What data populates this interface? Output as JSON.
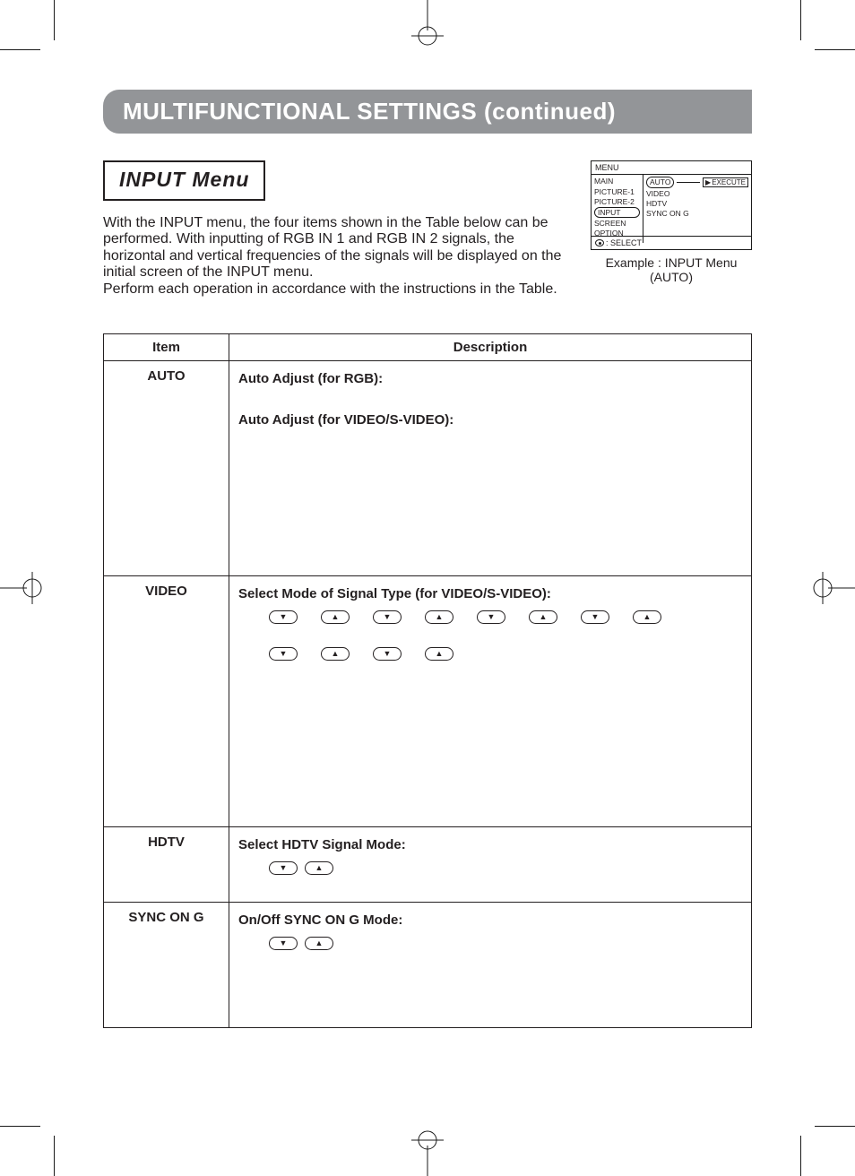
{
  "banner": "MULTIFUNCTIONAL SETTINGS (continued)",
  "section_title": "INPUT Menu",
  "intro": {
    "p1": "With the INPUT menu, the four items shown in the Table below can be performed. With inputting of RGB IN 1 and RGB IN 2 signals, the horizontal and vertical frequencies of the signals will be displayed on the initial screen of the INPUT menu.",
    "p2": "Perform each operation in accordance with the instructions in the Table."
  },
  "osd": {
    "title": "MENU",
    "left": [
      "MAIN",
      "PICTURE-1",
      "PICTURE-2",
      "INPUT",
      "SCREEN",
      "OPTION"
    ],
    "right": [
      "AUTO",
      "VIDEO",
      "HDTV",
      "SYNC ON G"
    ],
    "execute": "EXECUTE",
    "selected_left": "INPUT",
    "selected_right": "AUTO",
    "footer_icon": "disc-icon",
    "footer": ": SELECT",
    "caption_line1": "Example : INPUT Menu",
    "caption_line2": "(AUTO)"
  },
  "table": {
    "headers": {
      "item": "Item",
      "desc": "Description"
    },
    "rows": [
      {
        "item": "AUTO",
        "desc": {
          "heads": [
            "Auto Adjust (for RGB):",
            "Auto Adjust (for VIDEO/S-VIDEO):"
          ]
        }
      },
      {
        "item": "VIDEO",
        "desc": {
          "heads": [
            "Select Mode of Signal Type (for VIDEO/S-VIDEO):"
          ],
          "arrow_pairs": 6
        }
      },
      {
        "item": "HDTV",
        "desc": {
          "heads": [
            "Select HDTV Signal Mode:"
          ],
          "arrow_pairs": 1
        }
      },
      {
        "item": "SYNC ON G",
        "desc": {
          "heads": [
            "On/Off SYNC ON G Mode:"
          ],
          "arrow_pairs": 1
        }
      }
    ]
  }
}
